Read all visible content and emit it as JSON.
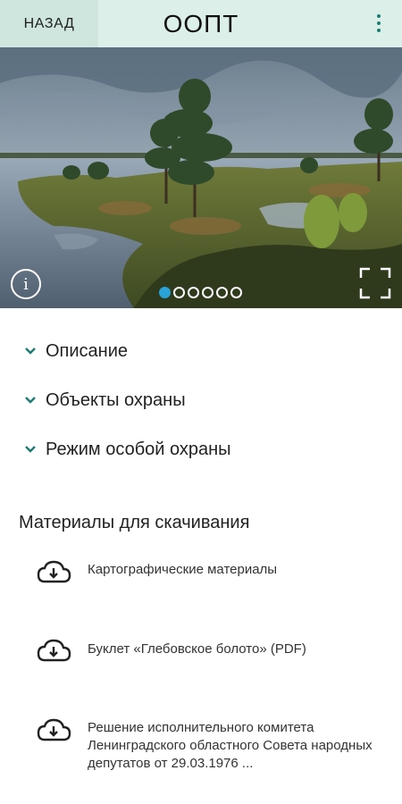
{
  "header": {
    "back_label": "НАЗАД",
    "title": "ООПТ",
    "menu_icon": "more-vertical-icon"
  },
  "gallery": {
    "info_label": "i",
    "total_images": 6,
    "active_index": 0
  },
  "accordion": [
    {
      "label": "Описание"
    },
    {
      "label": "Объекты охраны"
    },
    {
      "label": "Режим особой охраны"
    }
  ],
  "downloads": {
    "title": "Материалы для скачивания",
    "items": [
      {
        "label": "Картографические материалы"
      },
      {
        "label": "Буклет «Глебовское болото» (PDF)"
      },
      {
        "label": "Решение исполнительного комитета Ленинградского областного Совета народных депутатов от 29.03.1976 ..."
      }
    ]
  },
  "colors": {
    "header_bg": "#dcefe9",
    "back_bg": "#cfe6df",
    "accent": "#1c7c74",
    "dot_active": "#29a3d8"
  }
}
